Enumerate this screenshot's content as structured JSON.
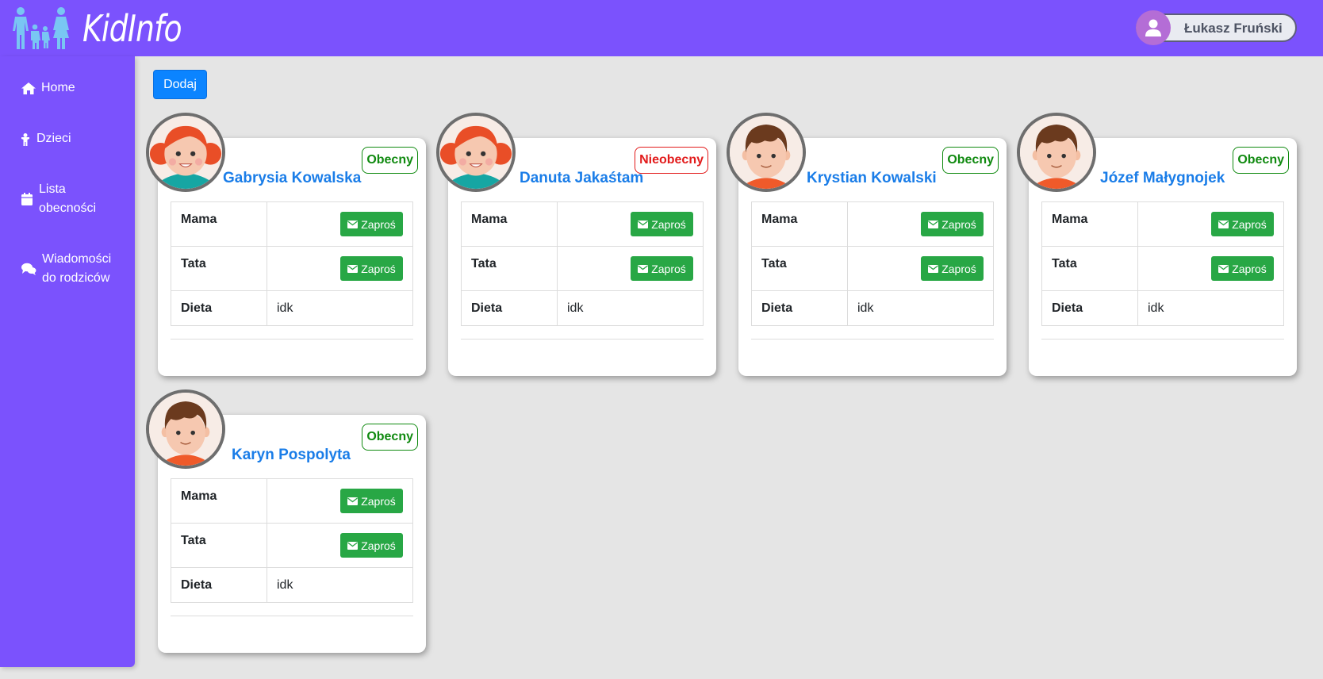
{
  "app": {
    "logo_text": "KidInfo"
  },
  "user": {
    "name": "Łukasz Fruński"
  },
  "sidebar": {
    "items": [
      {
        "label_lines": [
          "Home"
        ],
        "icon": "home-icon"
      },
      {
        "label_lines": [
          "Dzieci"
        ],
        "icon": "child-icon"
      },
      {
        "label_lines": [
          "Lista",
          "obecności"
        ],
        "icon": "calendar-icon"
      },
      {
        "label_lines": [
          "Wiadomości",
          "do rodziców"
        ],
        "icon": "chat-icon"
      }
    ]
  },
  "toolbar": {
    "add_label": "Dodaj"
  },
  "labels": {
    "mother": "Mama",
    "father": "Tata",
    "diet": "Dieta",
    "invite": "Zaproś"
  },
  "children": [
    {
      "name": "Gabrysia Kowalska",
      "status": "Obecny",
      "present": true,
      "avatar": "girl",
      "diet": "idk"
    },
    {
      "name": "Danuta Jakaśtam",
      "status": "Nieobecny",
      "present": false,
      "avatar": "girl",
      "diet": "idk"
    },
    {
      "name": "Krystian Kowalski",
      "status": "Obecny",
      "present": true,
      "avatar": "boy",
      "diet": "idk"
    },
    {
      "name": "Józef Małygnojek",
      "status": "Obecny",
      "present": true,
      "avatar": "boy",
      "diet": "idk"
    },
    {
      "name": "Karyn Pospolyta",
      "status": "Obecny",
      "present": true,
      "avatar": "boy",
      "diet": "idk"
    }
  ],
  "colors": {
    "brand": "#7b52fd",
    "accent": "#0b84ff",
    "success": "#28a745",
    "present": "#108a10",
    "absent": "#e21b1b",
    "name": "#1a7de8"
  }
}
